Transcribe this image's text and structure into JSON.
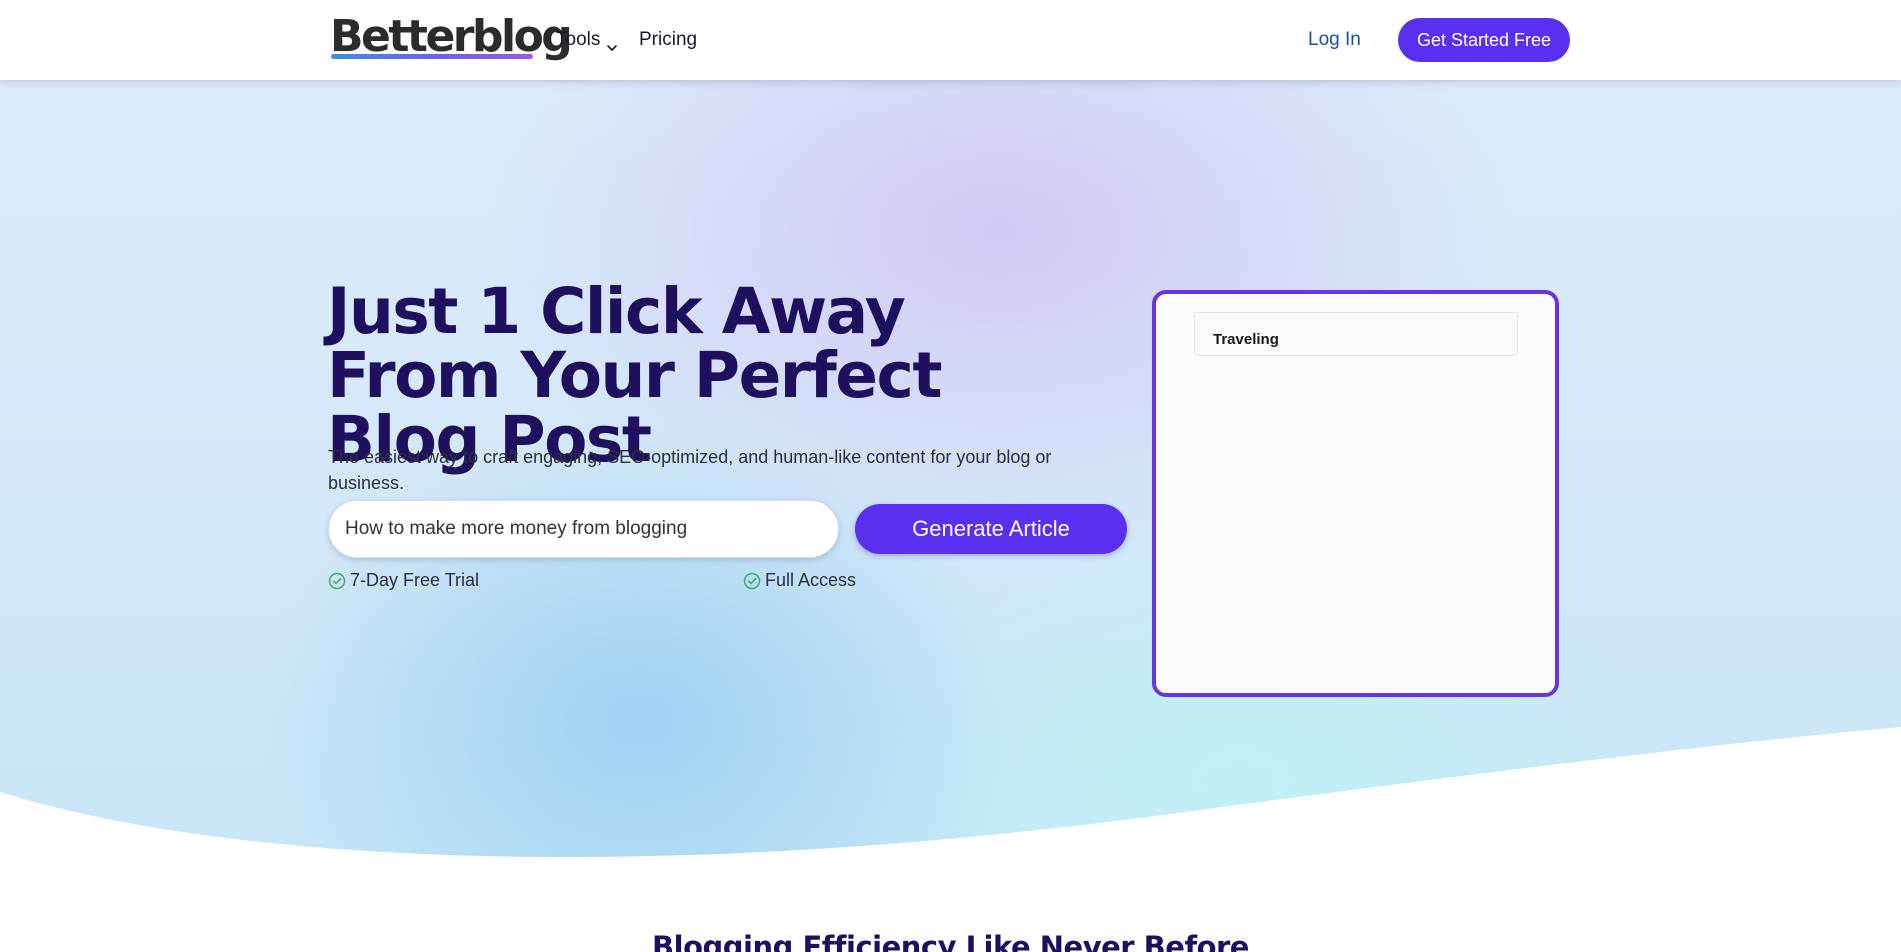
{
  "header": {
    "logo_text": "Betterblog",
    "nav": {
      "tools_label": "Tools",
      "pricing_label": "Pricing"
    },
    "login_label": "Log In",
    "cta_label": "Get Started Free"
  },
  "hero": {
    "title": "Just 1 Click Away From Your Perfect Blog Post",
    "subtitle": "The easiest way to craft engaging, SEO-optimized, and human-like content for your blog or business.",
    "input_value": "How to make more money from blogging",
    "generate_label": "Generate Article",
    "features": [
      {
        "label": "7-Day Free Trial",
        "icon": "check-circle-icon"
      },
      {
        "label": "Full Access",
        "icon": "check-circle-icon"
      }
    ],
    "preview_text": "Traveling"
  },
  "section": {
    "title": "Blogging Efficiency Like Never Before"
  },
  "colors": {
    "brand": "#5b2ff2",
    "heading": "#1f0f5e",
    "link": "#1f4ea3",
    "check": "#3fae6a",
    "card_border": "#6a35e0"
  }
}
